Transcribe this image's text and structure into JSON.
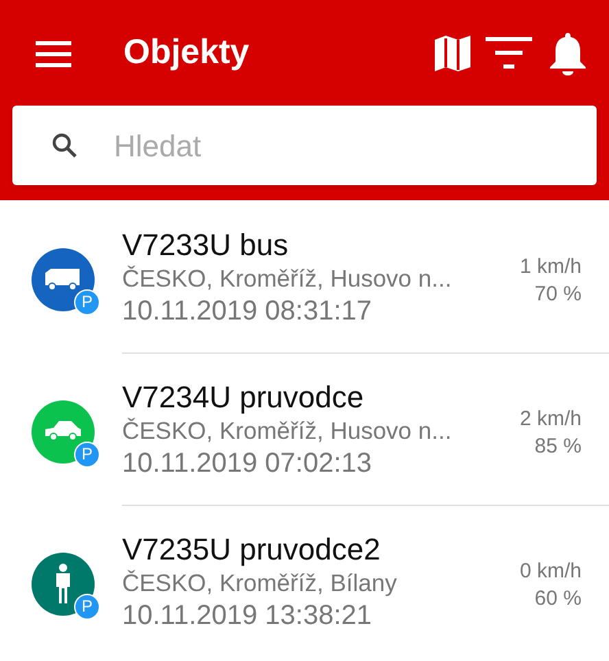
{
  "app_bar": {
    "title": "Objekty"
  },
  "search": {
    "placeholder": "Hledat"
  },
  "objects": [
    {
      "name": "V7233U bus",
      "address": "ČESKO, Kroměříž, Husovo n...",
      "time": "10.11.2019 08:31:17",
      "speed": "1 km/h",
      "percent": "70 %",
      "kind": "van",
      "color": "#1565c0",
      "badge": "P"
    },
    {
      "name": "V7234U pruvodce",
      "address": "ČESKO, Kroměříž, Husovo n...",
      "time": "10.11.2019 07:02:13",
      "speed": "2 km/h",
      "percent": "85 %",
      "kind": "car",
      "color": "#0cc24e",
      "badge": "P"
    },
    {
      "name": "V7235U pruvodce2",
      "address": "ČESKO, Kroměříž, Bílany",
      "time": "10.11.2019 13:38:21",
      "speed": "0 km/h",
      "percent": "60 %",
      "kind": "person",
      "color": "#00796b",
      "badge": "P"
    }
  ]
}
